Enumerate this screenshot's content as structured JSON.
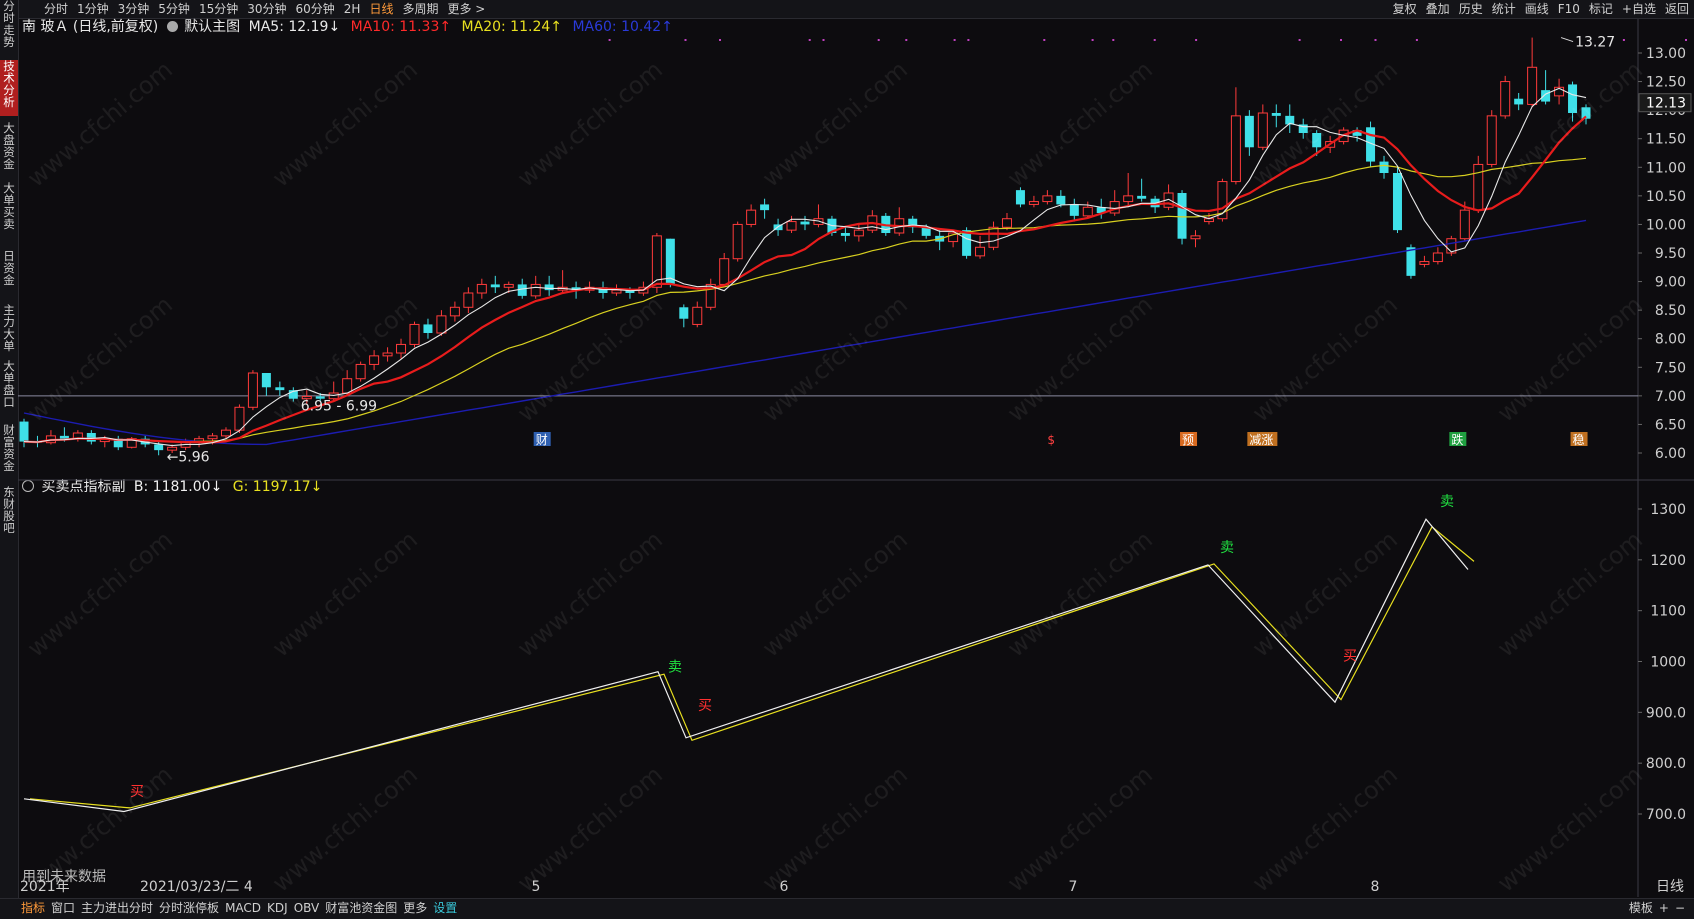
{
  "top_left_tab": "分时走势",
  "periods": [
    "分时",
    "1分钟",
    "3分钟",
    "5分钟",
    "15分钟",
    "30分钟",
    "60分钟",
    "2H",
    "日线",
    "多周期",
    "更多 >"
  ],
  "active_period": "日线",
  "tools_right": [
    "复权",
    "叠加",
    "历史",
    "统计",
    "画线",
    "F10",
    "标记",
    "+自选",
    "返回"
  ],
  "sidebar": [
    "分时走势",
    "技术分析",
    "大盘资金",
    "大单买卖",
    "日资金",
    "主力大单",
    "大单盘口",
    "财富资金",
    "东财股吧"
  ],
  "main_legend": {
    "stock": "南 玻Ａ (日线,前复权)",
    "template": "默认主图",
    "ma5": "MA5: 12.19↓",
    "ma10": "MA10: 11.33↑",
    "ma20": "MA20: 11.24↑",
    "ma60": "MA60: 10.42↑"
  },
  "sub_legend": {
    "name": "买卖点指标副",
    "b": "B: 1181.00↓",
    "g": "G: 1197.17↓"
  },
  "price_axis": [
    "13.00",
    "12.50",
    "12.00",
    "11.50",
    "11.00",
    "10.50",
    "10.00",
    "9.50",
    "9.00",
    "8.50",
    "8.00",
    "7.50",
    "7.00",
    "6.50",
    "6.00"
  ],
  "current_price": "12.13",
  "sub_axis": [
    "1300",
    "1200",
    "1100",
    "1000",
    "900.0",
    "800.0",
    "700.0"
  ],
  "annotations": {
    "high": "13.27",
    "low": "5.96",
    "range": "6.95 - 6.99"
  },
  "markers": [
    "财",
    "$",
    "预",
    "减涨",
    "跌",
    "稳"
  ],
  "signals": [
    "买",
    "卖",
    "买",
    "卖",
    "买",
    "卖"
  ],
  "future_note": "用到未来数据",
  "x_axis": [
    "2021年",
    "2021/03/23/二 4",
    "5",
    "6",
    "7",
    "8"
  ],
  "right_bottom_label": "日线",
  "bottom_tabs": [
    "指标",
    "窗口",
    "主力进出分时",
    "分时涨停板",
    "MACD",
    "KDJ",
    "OBV",
    "财富池资金图",
    "更多",
    "设置"
  ],
  "bottom_right": [
    "模板",
    "+",
    "−"
  ],
  "watermark": "www.cfchi.com",
  "colors": {
    "up": "#ff3b3b",
    "down": "#3fe0e8",
    "ma5": "#e8e8e8",
    "ma10": "#e81c1c",
    "ma20": "#d8d020",
    "ma60": "#1a1ab8"
  },
  "chart_data": {
    "type": "candlestick",
    "candles": [
      [
        6.55,
        6.2,
        6.6,
        6.1
      ],
      [
        6.2,
        6.18,
        6.3,
        6.1
      ],
      [
        6.18,
        6.3,
        6.4,
        6.15
      ],
      [
        6.3,
        6.25,
        6.45,
        6.2
      ],
      [
        6.25,
        6.35,
        6.4,
        6.2
      ],
      [
        6.35,
        6.2,
        6.4,
        6.15
      ],
      [
        6.2,
        6.25,
        6.3,
        6.1
      ],
      [
        6.25,
        6.1,
        6.3,
        6.05
      ],
      [
        6.1,
        6.25,
        6.28,
        6.08
      ],
      [
        6.25,
        6.15,
        6.3,
        6.1
      ],
      [
        6.15,
        6.05,
        6.2,
        5.96
      ],
      [
        6.05,
        6.1,
        6.15,
        6.0
      ],
      [
        6.1,
        6.2,
        6.25,
        6.05
      ],
      [
        6.2,
        6.25,
        6.3,
        6.1
      ],
      [
        6.25,
        6.3,
        6.35,
        6.15
      ],
      [
        6.3,
        6.4,
        6.45,
        6.25
      ],
      [
        6.4,
        6.8,
        6.85,
        6.35
      ],
      [
        6.8,
        7.4,
        7.45,
        6.75
      ],
      [
        7.4,
        7.15,
        7.4,
        7.0
      ],
      [
        7.15,
        7.1,
        7.25,
        7.0
      ],
      [
        7.1,
        6.95,
        7.15,
        6.9
      ],
      [
        6.95,
        6.99,
        7.1,
        6.85
      ],
      [
        6.99,
        6.95,
        7.05,
        6.9
      ],
      [
        6.95,
        7.05,
        7.25,
        6.9
      ],
      [
        7.05,
        7.3,
        7.45,
        7.0
      ],
      [
        7.3,
        7.55,
        7.6,
        7.25
      ],
      [
        7.55,
        7.7,
        7.8,
        7.45
      ],
      [
        7.7,
        7.75,
        7.85,
        7.6
      ],
      [
        7.75,
        7.9,
        8.0,
        7.65
      ],
      [
        7.9,
        8.25,
        8.3,
        7.85
      ],
      [
        8.25,
        8.1,
        8.35,
        8.0
      ],
      [
        8.1,
        8.4,
        8.5,
        8.05
      ],
      [
        8.4,
        8.55,
        8.65,
        8.3
      ],
      [
        8.55,
        8.8,
        8.9,
        8.45
      ],
      [
        8.8,
        8.95,
        9.05,
        8.7
      ],
      [
        8.95,
        8.9,
        9.1,
        8.8
      ],
      [
        8.9,
        8.95,
        9.0,
        8.8
      ],
      [
        8.95,
        8.75,
        9.05,
        8.7
      ],
      [
        8.75,
        8.95,
        9.1,
        8.7
      ],
      [
        8.95,
        8.85,
        9.1,
        8.75
      ],
      [
        8.85,
        8.9,
        9.2,
        8.8
      ],
      [
        8.9,
        8.85,
        9.0,
        8.7
      ],
      [
        8.85,
        8.9,
        9.0,
        8.8
      ],
      [
        8.9,
        8.8,
        9.0,
        8.7
      ],
      [
        8.8,
        8.85,
        8.95,
        8.75
      ],
      [
        8.85,
        8.8,
        8.9,
        8.7
      ],
      [
        8.8,
        8.9,
        9.0,
        8.75
      ],
      [
        8.9,
        9.8,
        9.85,
        8.8
      ],
      [
        9.75,
        8.95,
        9.75,
        8.9
      ],
      [
        8.55,
        8.35,
        8.6,
        8.2
      ],
      [
        8.25,
        8.55,
        8.65,
        8.2
      ],
      [
        8.55,
        8.95,
        9.05,
        8.5
      ],
      [
        8.95,
        9.4,
        9.5,
        8.9
      ],
      [
        9.4,
        10.0,
        10.05,
        9.35
      ],
      [
        10.0,
        10.25,
        10.35,
        9.95
      ],
      [
        10.35,
        10.25,
        10.45,
        10.1
      ],
      [
        10.0,
        9.9,
        10.1,
        9.8
      ],
      [
        9.9,
        10.05,
        10.15,
        9.85
      ],
      [
        10.05,
        10.0,
        10.15,
        9.9
      ],
      [
        10.0,
        10.1,
        10.35,
        9.95
      ],
      [
        10.1,
        9.85,
        10.15,
        9.8
      ],
      [
        9.85,
        9.8,
        9.95,
        9.7
      ],
      [
        9.8,
        9.9,
        10.0,
        9.7
      ],
      [
        9.9,
        10.15,
        10.25,
        9.85
      ],
      [
        10.15,
        9.85,
        10.2,
        9.8
      ],
      [
        9.85,
        10.1,
        10.3,
        9.8
      ],
      [
        10.1,
        9.95,
        10.15,
        9.85
      ],
      [
        9.95,
        9.8,
        10.0,
        9.75
      ],
      [
        9.8,
        9.7,
        9.9,
        9.55
      ],
      [
        9.7,
        9.85,
        9.9,
        9.6
      ],
      [
        9.9,
        9.45,
        9.95,
        9.4
      ],
      [
        9.45,
        9.6,
        9.8,
        9.4
      ],
      [
        9.6,
        9.95,
        10.05,
        9.55
      ],
      [
        9.95,
        10.1,
        10.2,
        9.9
      ],
      [
        10.6,
        10.35,
        10.65,
        10.3
      ],
      [
        10.35,
        10.4,
        10.5,
        10.3
      ],
      [
        10.4,
        10.5,
        10.6,
        10.35
      ],
      [
        10.5,
        10.35,
        10.6,
        10.3
      ],
      [
        10.35,
        10.15,
        10.45,
        10.05
      ],
      [
        10.15,
        10.3,
        10.4,
        10.1
      ],
      [
        10.3,
        10.2,
        10.45,
        10.1
      ],
      [
        10.2,
        10.4,
        10.6,
        10.15
      ],
      [
        10.4,
        10.5,
        10.9,
        10.3
      ],
      [
        10.5,
        10.45,
        10.8,
        10.4
      ],
      [
        10.45,
        10.3,
        10.5,
        10.2
      ],
      [
        10.3,
        10.55,
        10.7,
        10.25
      ],
      [
        10.55,
        9.75,
        10.6,
        9.65
      ],
      [
        9.75,
        9.8,
        9.9,
        9.6
      ],
      [
        10.05,
        10.1,
        10.2,
        10.0
      ],
      [
        10.1,
        10.75,
        10.8,
        10.05
      ],
      [
        10.75,
        11.9,
        12.4,
        10.7
      ],
      [
        11.9,
        11.35,
        12.0,
        11.2
      ],
      [
        11.35,
        11.95,
        12.1,
        11.3
      ],
      [
        11.95,
        11.9,
        12.1,
        11.7
      ],
      [
        11.9,
        11.75,
        12.1,
        11.6
      ],
      [
        11.75,
        11.6,
        11.85,
        11.5
      ],
      [
        11.6,
        11.35,
        11.65,
        11.2
      ],
      [
        11.35,
        11.45,
        11.55,
        11.25
      ],
      [
        11.45,
        11.65,
        11.7,
        11.4
      ],
      [
        11.65,
        11.55,
        11.7,
        11.45
      ],
      [
        11.7,
        11.1,
        11.8,
        11.0
      ],
      [
        11.1,
        10.9,
        11.2,
        10.8
      ],
      [
        10.9,
        9.9,
        11.0,
        9.85
      ],
      [
        9.6,
        9.1,
        9.65,
        9.05
      ],
      [
        9.3,
        9.35,
        9.45,
        9.25
      ],
      [
        9.35,
        9.5,
        9.6,
        9.3
      ],
      [
        9.5,
        9.75,
        9.8,
        9.45
      ],
      [
        9.75,
        10.25,
        10.4,
        9.7
      ],
      [
        10.25,
        11.05,
        11.2,
        10.2
      ],
      [
        11.05,
        11.9,
        12.0,
        11.0
      ],
      [
        11.9,
        12.5,
        12.6,
        11.85
      ],
      [
        12.2,
        12.1,
        12.3,
        12.0
      ],
      [
        12.1,
        12.75,
        13.27,
        12.05
      ],
      [
        12.35,
        12.15,
        12.7,
        12.1
      ],
      [
        12.25,
        12.4,
        12.55,
        12.1
      ],
      [
        12.45,
        11.95,
        12.5,
        11.8
      ],
      [
        12.05,
        11.85,
        12.1,
        11.75
      ]
    ],
    "sub_b": [
      730,
      705,
      980,
      850,
      1190,
      920,
      1280,
      1181
    ],
    "sub_g": [
      730,
      712,
      975,
      845,
      1192,
      925,
      1265,
      1197
    ]
  }
}
